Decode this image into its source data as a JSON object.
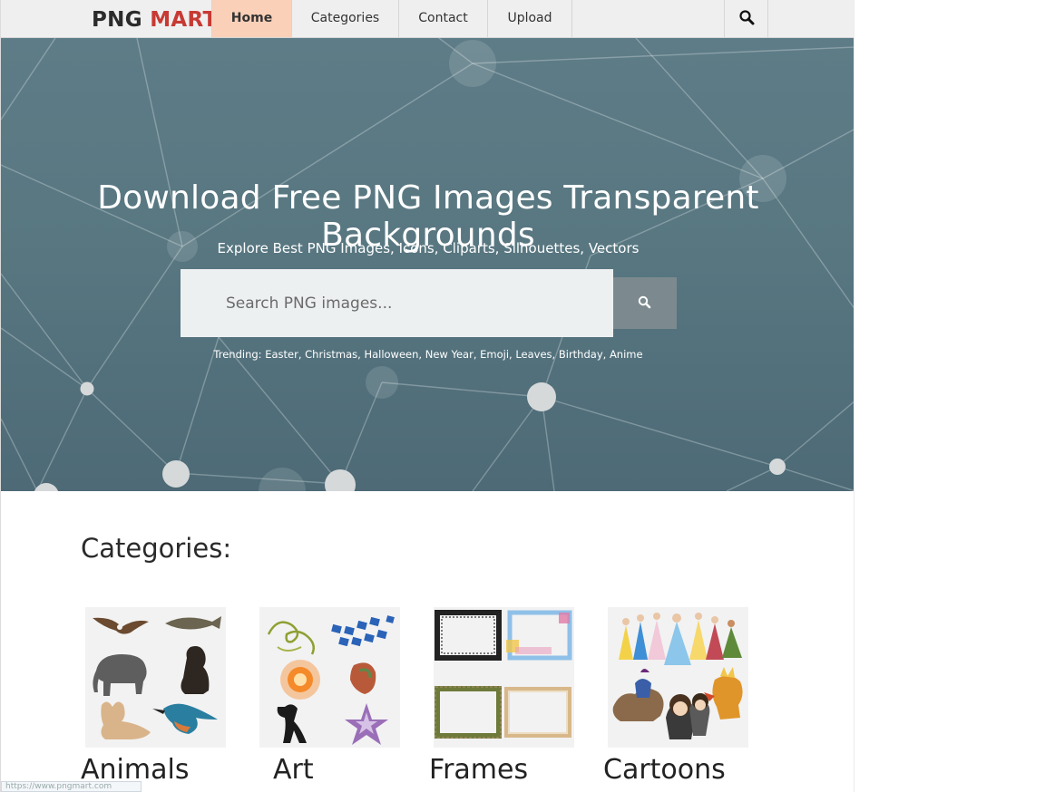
{
  "brand": {
    "logo_part1": "PNG",
    "logo_part2": "MART"
  },
  "nav": {
    "items": [
      {
        "label": "Home",
        "active": true
      },
      {
        "label": "Categories",
        "active": false
      },
      {
        "label": "Contact",
        "active": false
      },
      {
        "label": "Upload",
        "active": false
      }
    ],
    "search_icon": "search-icon"
  },
  "hero": {
    "title": "Download Free PNG Images Transparent Backgrounds",
    "subtitle": "Explore Best PNG Images, Icons, Cliparts, Silhouettes, Vectors",
    "search_placeholder": "Search PNG images...",
    "search_button_icon": "search-icon",
    "trending_label": "Trending:",
    "trending": [
      "Easter",
      "Christmas",
      "Halloween",
      "New Year",
      "Emoji",
      "Leaves",
      "Birthday",
      "Anime"
    ]
  },
  "categories": {
    "heading": "Categories:",
    "items": [
      {
        "label": "Animals",
        "icon": "animals-thumbnail"
      },
      {
        "label": "Art",
        "icon": "art-thumbnail"
      },
      {
        "label": "Frames",
        "icon": "frames-thumbnail"
      },
      {
        "label": "Cartoons",
        "icon": "cartoons-thumbnail"
      }
    ]
  },
  "colors": {
    "accent_active_tab": "#fbd0b8",
    "logo_red": "#c73a34",
    "hero_bg": "#587781",
    "search_button": "#7c8a8f"
  },
  "statusbar": {
    "text": "https://www.pngmart.com"
  }
}
